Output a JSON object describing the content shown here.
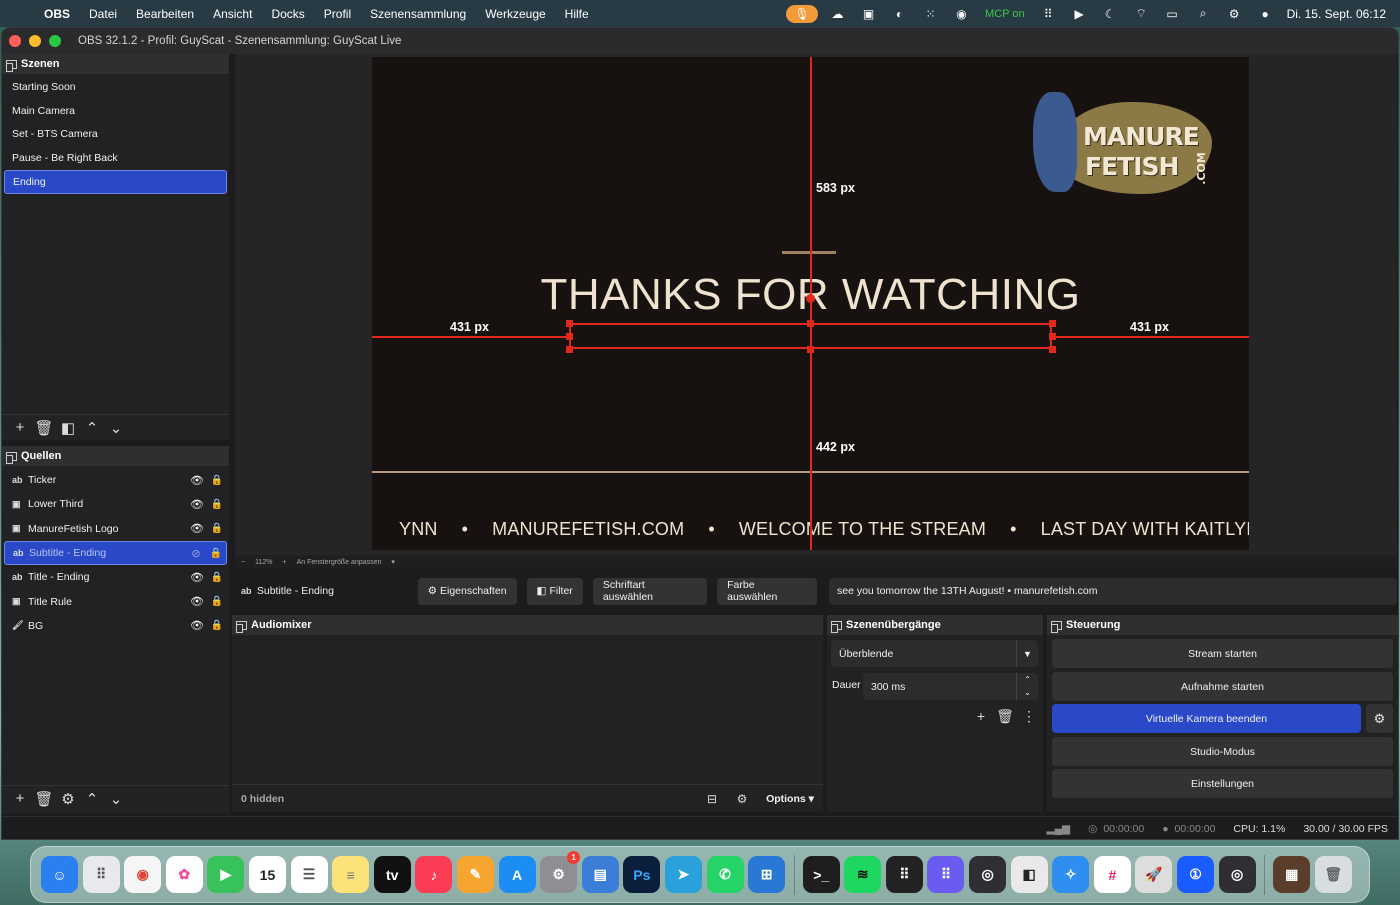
{
  "menubar": {
    "app": "OBS",
    "items": [
      "Datei",
      "Bearbeiten",
      "Ansicht",
      "Docks",
      "Profil",
      "Szenensammlung",
      "Werkzeuge",
      "Hilfe"
    ],
    "mcp_status": "MCP on",
    "clock": "Di. 15. Sept.  06:12"
  },
  "window": {
    "title": "OBS 32.1.2 - Profil: GuyScat - Szenensammlung: GuyScat Live"
  },
  "scenes": {
    "header": "Szenen",
    "items": [
      "Starting Soon",
      "Main Camera",
      "Set - BTS Camera",
      "Pause - Be Right Back",
      "Ending"
    ],
    "selected": "Ending"
  },
  "sources": {
    "header": "Quellen",
    "items": [
      {
        "type": "ab",
        "icon": "text-icon",
        "name": "Ticker"
      },
      {
        "type": "▣",
        "icon": "image-icon",
        "name": "Lower Third"
      },
      {
        "type": "▣",
        "icon": "image-icon",
        "name": "ManureFetish Logo"
      },
      {
        "type": "ab",
        "icon": "text-icon",
        "name": "Subtitle - Ending"
      },
      {
        "type": "ab",
        "icon": "text-icon",
        "name": "Title - Ending"
      },
      {
        "type": "▣",
        "icon": "image-icon",
        "name": "Title Rule"
      },
      {
        "type": "🖌",
        "icon": "brush-icon",
        "name": "BG"
      }
    ],
    "selected": "Subtitle - Ending"
  },
  "preview": {
    "logo_line1": "MANURE",
    "logo_line2": "FETISH",
    "logo_line3": ".COM",
    "headline": "THANKS FOR WATCHING",
    "ticker": [
      "YNN",
      "MANUREFETISH.COM",
      "WELCOME TO THE STREAM",
      "LAST DAY WITH KAITLYN KAT"
    ],
    "ticker_sep": "•",
    "measure_top": "583 px",
    "measure_left": "431 px",
    "measure_right": "431 px",
    "measure_bottom": "442 px"
  },
  "zoombar": {
    "minus": "−",
    "zoom": "112%",
    "plus": "+",
    "fit": "An Fenstergröße anpassen"
  },
  "contextbar": {
    "source_name": "Subtitle - Ending",
    "properties": "Eigenschaften",
    "filter": "Filter",
    "font": "Schriftart auswählen",
    "color": "Farbe auswählen",
    "text_value": "see you tomorrow the 13TH August! • manurefetish.com"
  },
  "audiomixer": {
    "header": "Audiomixer",
    "hidden": "0 hidden",
    "options": "Options"
  },
  "transitions": {
    "header": "Szenenübergänge",
    "selected": "Überblende",
    "duration_label": "Dauer",
    "duration_value": "300 ms"
  },
  "controls": {
    "header": "Steuerung",
    "stream": "Stream starten",
    "record": "Aufnahme starten",
    "virtual_cam": "Virtuelle Kamera beenden",
    "studio": "Studio-Modus",
    "settings": "Einstellungen"
  },
  "statusbar": {
    "stream_time": "00:00:00",
    "record_time": "00:00:00",
    "cpu": "CPU: 1.1%",
    "fps": "30.00 / 30.00 FPS"
  },
  "dock": {
    "calendar_day": "15",
    "settings_badge": "1",
    "apps": [
      "finder",
      "launchpad",
      "chrome",
      "photos",
      "facetime",
      "calendar",
      "reminders",
      "notes",
      "apple-tv",
      "music",
      "pages",
      "app-store",
      "system-settings",
      "preview",
      "photoshop",
      "telegram",
      "whatsapp",
      "windows-app",
      "terminal",
      "spotify",
      "deck",
      "mosaic",
      "obs",
      "davinci-capture",
      "safari",
      "slack",
      "rocket",
      "1password",
      "obs-2",
      "archive",
      "trash"
    ]
  },
  "colors": {
    "accent": "#2a49c9",
    "guide_red": "#e0281f",
    "canvas_bg": "#17120f",
    "text_cream": "#efe2cf"
  }
}
